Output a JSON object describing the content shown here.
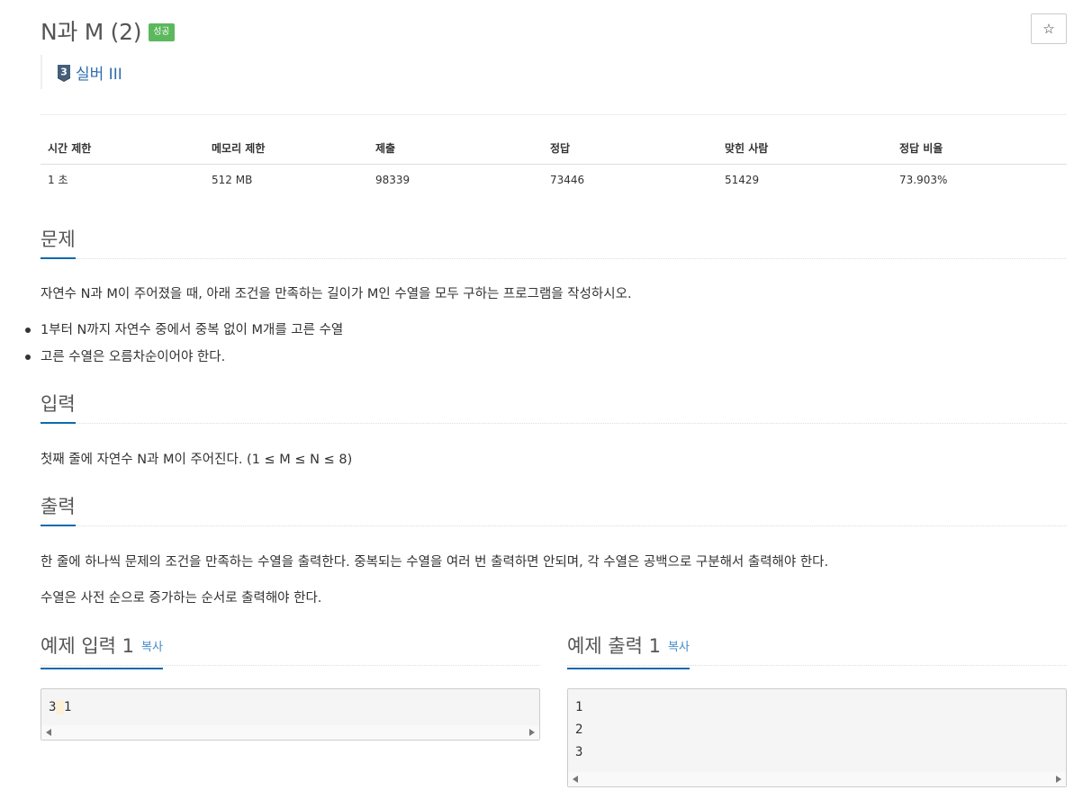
{
  "problem": {
    "title": "N과 M (2)",
    "status_badge": "성공",
    "star_icon": "☆",
    "tier": {
      "level_digit": "3",
      "label": "실버 III",
      "color": "#435f7a"
    }
  },
  "stats": {
    "headers": [
      "시간 제한",
      "메모리 제한",
      "제출",
      "정답",
      "맞힌 사람",
      "정답 비율"
    ],
    "values": [
      "1 초",
      "512 MB",
      "98339",
      "73446",
      "51429",
      "73.903%"
    ]
  },
  "sections": {
    "description": {
      "heading": "문제",
      "intro": "자연수 N과 M이 주어졌을 때, 아래 조건을 만족하는 길이가 M인 수열을 모두 구하는 프로그램을 작성하시오.",
      "conditions": [
        "1부터 N까지 자연수 중에서 중복 없이 M개를 고른 수열",
        "고른 수열은 오름차순이어야 한다."
      ]
    },
    "input": {
      "heading": "입력",
      "text": "첫째 줄에 자연수 N과 M이 주어진다. (1 ≤ M ≤ N ≤ 8)"
    },
    "output": {
      "heading": "출력",
      "paragraphs": [
        "한 줄에 하나씩 문제의 조건을 만족하는 수열을 출력한다. 중복되는 수열을 여러 번 출력하면 안되며, 각 수열은 공백으로 구분해서 출력해야 한다.",
        "수열은 사전 순으로 증가하는 순서로 출력해야 한다."
      ]
    }
  },
  "samples": {
    "input": {
      "heading": "예제 입력 1",
      "copy_label": "복사",
      "first": "3",
      "gap": " ",
      "second": "1"
    },
    "output": {
      "heading": "예제 출력 1",
      "copy_label": "복사",
      "lines": [
        "1",
        "2",
        "3"
      ]
    }
  },
  "colors": {
    "accent": "#0d6aad",
    "badge": "#5cb85c",
    "link": "#428bca"
  }
}
